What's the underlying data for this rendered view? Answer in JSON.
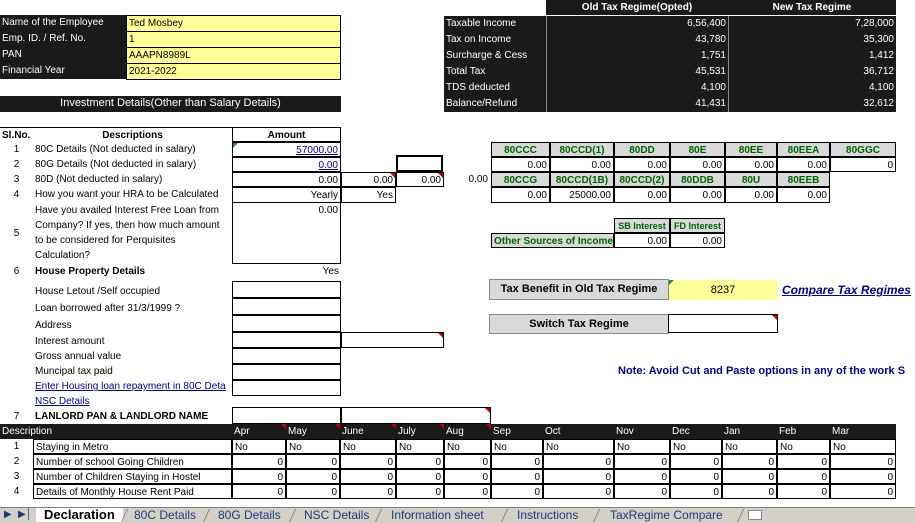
{
  "employee": {
    "rows": [
      {
        "label": "Name of the Employee",
        "value": "Ted Mosbey"
      },
      {
        "label": "Emp. ID.  / Ref. No.",
        "value": "1"
      },
      {
        "label": "PAN",
        "value": "AAAPN8989L"
      },
      {
        "label": "Financial Year",
        "value": "2021-2022"
      }
    ]
  },
  "regimes": {
    "old_label": "Old Tax Regime(Opted)",
    "new_label": "New Tax Regime",
    "rows": [
      {
        "label": "Taxable Income",
        "old": "6,56,400",
        "new": "7,28,000"
      },
      {
        "label": "Tax on Income",
        "old": "43,780",
        "new": "35,300"
      },
      {
        "label": "Surcharge & Cess",
        "old": "1,751",
        "new": "1,412"
      },
      {
        "label": "Total  Tax",
        "old": "45,531",
        "new": "36,712"
      },
      {
        "label": "TDS deducted",
        "old": "4,100",
        "new": "4,100"
      },
      {
        "label": "Balance/Refund",
        "old": "41,431",
        "new": "32,612"
      }
    ]
  },
  "investment_header": "Investment Details(Other than Salary Details)",
  "table_head": {
    "slno": "Sl.No.",
    "desc": "Descriptions",
    "amount": "Amount"
  },
  "inv": {
    "r1": {
      "n": "1",
      "d": "80C Details (Not deducted in salary)",
      "amt": "57000.00"
    },
    "r2": {
      "n": "2",
      "d": "80G Details (Not deducted in salary)",
      "amt": "0.00"
    },
    "r3": {
      "n": "3",
      "d": "80D         (Not deducted in salary)",
      "amt": "0.00",
      "x1": "0.00",
      "x2": "0.00",
      "x3": "0.00"
    },
    "r4": {
      "n": "4",
      "d": "How you want your HRA to be Calculated",
      "amt": "Yearly",
      "x1": "Yes"
    },
    "r5": {
      "n": "5",
      "l1": "Have you availed Interest Free Loan from",
      "l2": "Company? If yes, then how much amount",
      "l3": "to be considered for Perquisites",
      "l4": "Calculation?",
      "amt": "0.00"
    },
    "r6": {
      "n": "6",
      "d": "House Property Details",
      "amt": "Yes"
    },
    "hp": [
      "House Letout /Self occupied",
      "Loan borrowed after 31/3/1999 ?",
      "Address",
      "Interest amount",
      "Gross annual value",
      "Muncipal tax paid"
    ],
    "link1": "Enter Housing loan repayment in 80C Deta",
    "link2": "NSC Details",
    "r7": {
      "n": "7",
      "d": "LANLORD PAN & LANDLORD NAME"
    }
  },
  "deductions": {
    "head1": [
      "80CCC",
      "80CCD(1)",
      "80DD",
      "80E",
      "80EE",
      "80EEA",
      "80GGC"
    ],
    "val1": [
      "0.00",
      "0.00",
      "0.00",
      "0.00",
      "0.00",
      "0.00",
      "0"
    ],
    "head2": [
      "80CCG",
      "80CCD(1B)",
      "80CCD(2)",
      "80DDB",
      "80U",
      "80EEB"
    ],
    "val2": [
      "0.00",
      "25000.00",
      "0.00",
      "0.00",
      "0.00",
      "0.00"
    ]
  },
  "other_sources": {
    "label": "Other Sources of Income",
    "sb_label": "SB Interest",
    "fd_label": "FD Interest",
    "sb": "0.00",
    "fd": "0.00"
  },
  "benefit": {
    "label": "Tax Benefit in Old Tax Regime",
    "value": "8237",
    "compare": "Compare Tax Regimes"
  },
  "switch": {
    "label": "Switch Tax Regime"
  },
  "note": "Note: Avoid Cut and Paste options in any of the work S",
  "months": {
    "desc_label": "Description",
    "names": [
      "Apr",
      "May",
      "June",
      "July",
      "Aug",
      "Sep",
      "Oct",
      "Nov",
      "Dec",
      "Jan",
      "Feb",
      "Mar"
    ],
    "rows": [
      {
        "n": "1",
        "label": "Staying in Metro",
        "vals": [
          "No",
          "No",
          "No",
          "No",
          "No",
          "No",
          "No",
          "No",
          "No",
          "No",
          "No",
          "No"
        ]
      },
      {
        "n": "2",
        "label": "Number of school Going Children",
        "vals": [
          "0",
          "0",
          "0",
          "0",
          "0",
          "0",
          "0",
          "0",
          "0",
          "0",
          "0",
          "0"
        ]
      },
      {
        "n": "3",
        "label": "Number of Children Staying in Hostel",
        "vals": [
          "0",
          "0",
          "0",
          "0",
          "0",
          "0",
          "0",
          "0",
          "0",
          "0",
          "0",
          "0"
        ]
      },
      {
        "n": "4",
        "label": "Details of Monthly House Rent Paid",
        "vals": [
          "0",
          "0",
          "0",
          "0",
          "0",
          "0",
          "0",
          "0",
          "0",
          "0",
          "0",
          "0"
        ]
      }
    ]
  },
  "tabs": [
    "Declaration",
    "80C Details",
    "80G Details",
    "NSC Details",
    "Information sheet",
    "Instructions",
    "TaxRegime  Compare"
  ]
}
